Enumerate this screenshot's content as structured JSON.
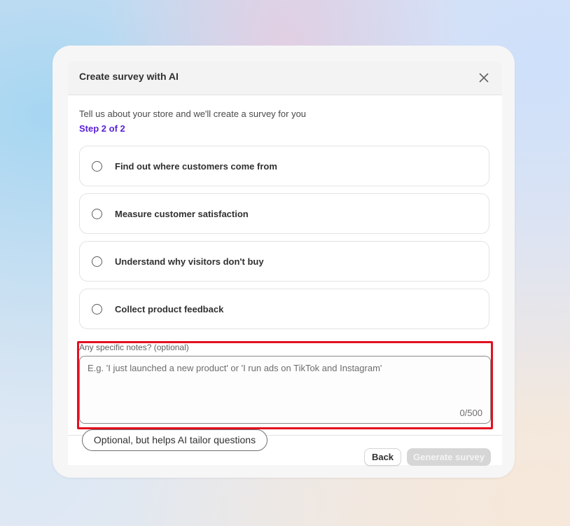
{
  "modal": {
    "title": "Create survey with AI",
    "close_icon": "close-icon",
    "intro_text": "Tell us about your store and we'll create a survey for you",
    "step_text": "Step 2 of 2",
    "accent_color": "#5a1fd6"
  },
  "options": [
    {
      "label": "Find out where customers come from",
      "selected": false
    },
    {
      "label": "Measure customer satisfaction",
      "selected": false
    },
    {
      "label": "Understand why visitors don't buy",
      "selected": false
    },
    {
      "label": "Collect product feedback",
      "selected": false
    }
  ],
  "notes": {
    "label": "Any specific notes? (optional)",
    "placeholder": "E.g. 'I just launched a new product' or 'I run ads on TikTok and Instagram'",
    "value": "",
    "char_count": "0/500",
    "tooltip": "Optional, but helps AI tailor questions"
  },
  "footer": {
    "back_label": "Back",
    "generate_label": "Generate survey",
    "generate_disabled": true
  },
  "annotation": {
    "highlight_color": "#e3101f"
  }
}
